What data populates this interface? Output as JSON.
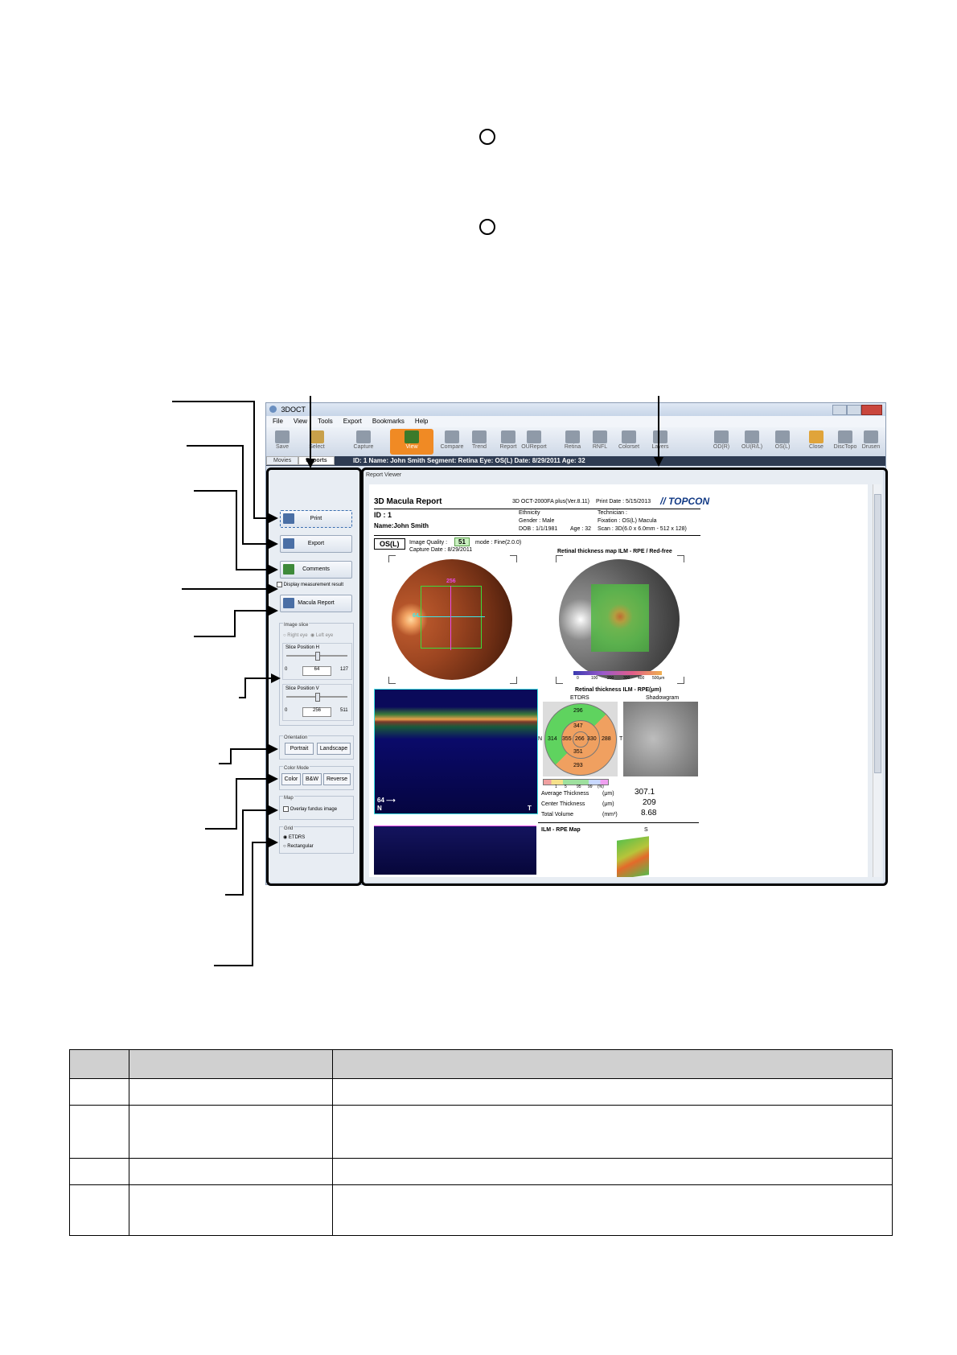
{
  "window": {
    "title": "3DOCT",
    "menu": [
      "File",
      "View",
      "Tools",
      "Export",
      "Bookmarks",
      "Help"
    ],
    "toolbar": [
      {
        "label": "Save",
        "icon": "save-icon"
      },
      {
        "label": "Select",
        "icon": "select-icon"
      },
      {
        "label": "Capture",
        "icon": "capture-icon"
      },
      {
        "label": "View",
        "icon": "view-icon"
      },
      {
        "label": "Compare",
        "icon": "compare-icon"
      },
      {
        "label": "Trend",
        "icon": "trend-icon"
      },
      {
        "label": "Report",
        "icon": "report-icon"
      },
      {
        "label": "OUReport",
        "icon": "oureport-icon"
      },
      {
        "label": "Retina",
        "icon": "retina-icon"
      },
      {
        "label": "RNFL",
        "icon": "rnfl-icon"
      },
      {
        "label": "Colorset",
        "icon": "colorset-icon"
      },
      {
        "label": "Layers",
        "icon": "layers-icon"
      },
      {
        "label": "OD(R)",
        "icon": "od-icon"
      },
      {
        "label": "OU(R/L)",
        "icon": "ou-icon"
      },
      {
        "label": "OS(L)",
        "icon": "os-icon"
      },
      {
        "label": "Close",
        "icon": "close-icon"
      },
      {
        "label": "DiscTopo",
        "icon": "disctopo-icon"
      },
      {
        "label": "Drusen",
        "icon": "drusen-icon"
      }
    ],
    "tabs": [
      "Movies",
      "Reports"
    ],
    "info": "ID: 1   Name: John Smith   Segment: Retina   Eye: OS(L)   Date: 8/29/2011   Age: 32"
  },
  "left_panel": {
    "print": "Print",
    "export": "Export",
    "comments": "Comments",
    "display_measurement": "Display measurement result",
    "macula_report": "Macula Report",
    "image_slice": {
      "label": "Image slice",
      "radio_a": "Right eye",
      "radio_b": "Left eye",
      "slice_h_label": "Slice Position H",
      "slice_h_min": "0",
      "slice_h_value": "64",
      "slice_h_max": "127",
      "slice_v_label": "Slice Position V",
      "slice_v_min": "0",
      "slice_v_value": "256",
      "slice_v_max": "511"
    },
    "orientation": {
      "label": "Orientation",
      "portrait": "Portrait",
      "landscape": "Landscape"
    },
    "color_mode": {
      "label": "Color Mode",
      "color": "Color",
      "bw": "B&W",
      "reverse": "Reverse"
    },
    "map": {
      "label": "Map",
      "overlay": "Overlay fundus image"
    },
    "grid": {
      "label": "Grid",
      "etdrs": "ETDRS",
      "rect": "Rectangular"
    }
  },
  "viewer": {
    "title": "Report Viewer",
    "report": {
      "heading": "3D Macula Report",
      "device": "3D OCT-2000FA plus(Ver.8.11)",
      "print_date": "Print Date : 5/15/2013",
      "brand": "TOPCON",
      "id": "ID : 1",
      "name": "Name:John Smith",
      "ethnicity": "Ethnicity",
      "gender": "Gender : Male",
      "dob": "DOB : 1/1/1981",
      "technician": "Technician :",
      "fixation": "Fixation : OS(L) Macula",
      "age": "Age : 32",
      "scan": "Scan : 3D(6.0 x 6.0mm - 512 x 128)",
      "eye": "OS(L)",
      "image_quality_label": "Image Quality :",
      "image_quality": "51",
      "mode": "mode : Fine(2.0.0)",
      "capture_date": "Capture Date : 8/29/2011",
      "fundus_h_marker": "256",
      "fundus_v_marker": "64",
      "map_title": "Retinal thickness map ILM - RPE / Red-free",
      "map_scale": [
        "0",
        "100",
        "200",
        "300",
        "400",
        "500μm"
      ],
      "etdrs_title": "Retinal thickness ILM - RPE(μm)",
      "etdrs_label": "ETDRS",
      "shadowgram_label": "Shadowgram",
      "etdrs_values": {
        "superior_outer": "296",
        "superior_inner": "347",
        "nasal_outer": "314",
        "nasal_inner": "355",
        "center": "266",
        "temporal_inner": "330",
        "temporal_outer": "288",
        "inferior_inner": "351",
        "inferior_outer": "293"
      },
      "etdrs_n": "N",
      "etdrs_t": "T",
      "legend_ticks": [
        "1",
        "5",
        "95",
        "99",
        "(%)"
      ],
      "avg_label": "Average Thickness",
      "avg_unit": "(μm)",
      "avg_value": "307.1",
      "center_label": "Center Thickness",
      "center_unit": "(μm)",
      "center_value": "209",
      "volume_label": "Total Volume",
      "volume_unit": "(mm³)",
      "volume_value": "8.68",
      "bscan_slice": "64",
      "bscan_n": "N",
      "bscan_t": "T",
      "ilm_rpe_title": "ILM - RPE Map",
      "ilm_rpe_s": "S"
    }
  },
  "colors": {
    "accent": "#f08a24",
    "info_bar": "#2e3b52",
    "table_header": "#d0d0d0"
  }
}
